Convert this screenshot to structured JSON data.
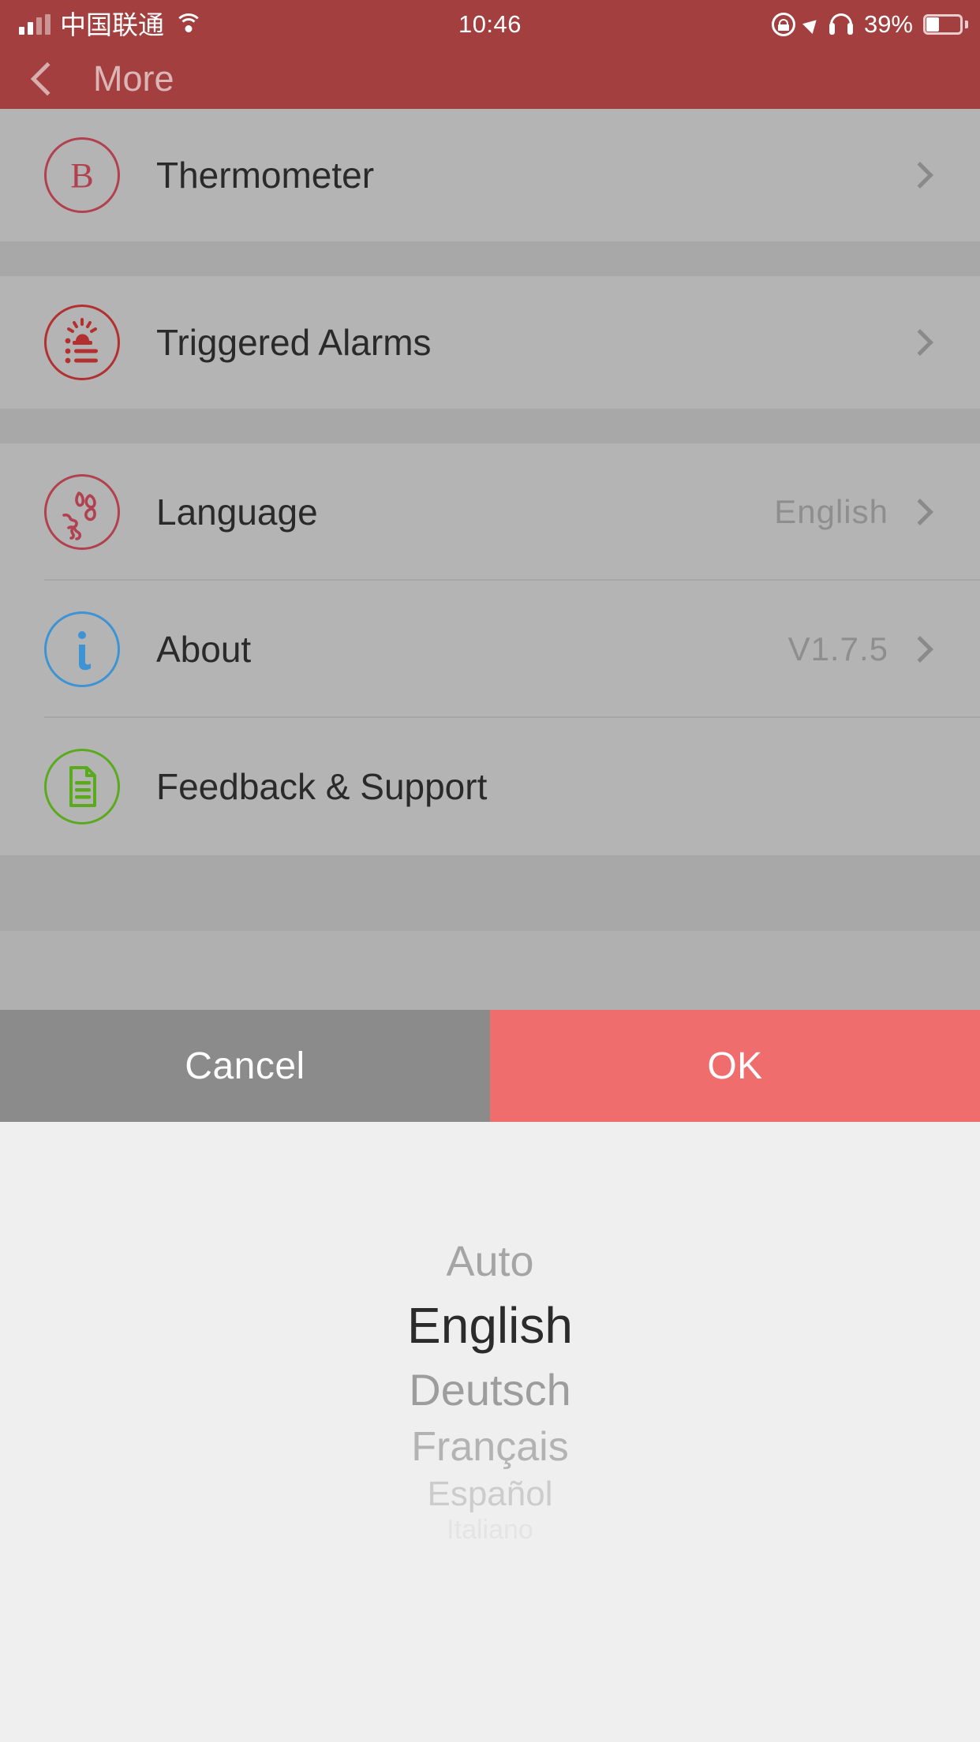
{
  "status_bar": {
    "carrier": "中国联通",
    "signal_icon": "signal-bars-icon",
    "wifi_icon": "wifi-icon",
    "time": "10:46",
    "rotation_lock_icon": "rotation-lock-icon",
    "location_icon": "location-arrow-icon",
    "headphones_icon": "headphones-icon",
    "battery_percent": "39%",
    "battery_icon": "battery-icon"
  },
  "navbar": {
    "back_icon": "chevron-left-icon",
    "title": "More"
  },
  "settings": {
    "groups": [
      {
        "rows": [
          {
            "label": "Thermometer",
            "value": "",
            "icon": "thermometer-b-icon",
            "icon_color": "#b2414f",
            "chevron": true
          }
        ]
      },
      {
        "rows": [
          {
            "label": "Triggered Alarms",
            "value": "",
            "icon": "alarm-list-icon",
            "icon_color": "#b23030",
            "chevron": true
          }
        ]
      },
      {
        "rows": [
          {
            "label": "Language",
            "value": "English",
            "icon": "globe-icon",
            "icon_color": "#b2414f",
            "chevron": true
          },
          {
            "label": "About",
            "value": "V1.7.5",
            "icon": "info-icon",
            "icon_color": "#3d93d4",
            "chevron": true
          },
          {
            "label": "Feedback & Support",
            "value": "",
            "icon": "document-icon",
            "icon_color": "#5aaa1e",
            "chevron": false
          }
        ]
      }
    ]
  },
  "action_bar": {
    "cancel_label": "Cancel",
    "ok_label": "OK",
    "cancel_color": "#8b8b8b",
    "ok_color": "#ef6d6d"
  },
  "language_picker": {
    "options": [
      "Auto",
      "English",
      "Deutsch",
      "Français",
      "Español",
      "Italiano"
    ],
    "selected": "English",
    "selected_index": 1
  },
  "theme": {
    "brand_red": "#a33f3f",
    "sheet_background": "#efefef",
    "dimmed_list_background": "#b4b4b4",
    "accent_ok": "#ef6d6d"
  }
}
